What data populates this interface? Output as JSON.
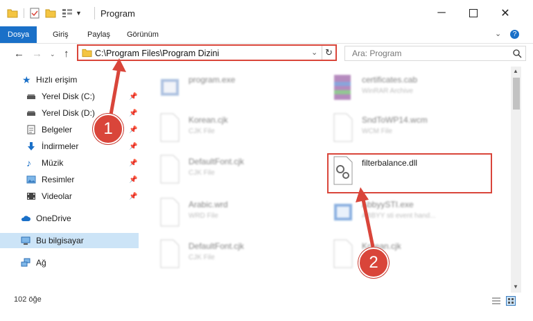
{
  "window": {
    "title": "Program"
  },
  "ribbon": {
    "tabs": [
      "Dosya",
      "Giriş",
      "Paylaş",
      "Görünüm"
    ]
  },
  "address": {
    "path": "C:\\Program Files\\Program Dizini"
  },
  "search": {
    "placeholder": "Ara: Program"
  },
  "sidebar": {
    "items": [
      {
        "label": "Hızlı erişim",
        "icon": "star-icon"
      },
      {
        "label": "Yerel Disk (C:)",
        "icon": "drive-icon",
        "pinned": true
      },
      {
        "label": "Yerel Disk (D:)",
        "icon": "drive-icon",
        "pinned": true
      },
      {
        "label": "Belgeler",
        "icon": "documents-icon",
        "pinned": true
      },
      {
        "label": "İndirmeler",
        "icon": "download-icon",
        "pinned": true
      },
      {
        "label": "Müzik",
        "icon": "music-icon",
        "pinned": true
      },
      {
        "label": "Resimler",
        "icon": "pictures-icon",
        "pinned": true
      },
      {
        "label": "Videolar",
        "icon": "videos-icon",
        "pinned": true
      },
      {
        "label": "OneDrive",
        "icon": "cloud-icon"
      },
      {
        "label": "Bu bilgisayar",
        "icon": "computer-icon",
        "selected": true
      },
      {
        "label": "Ağ",
        "icon": "network-icon"
      }
    ]
  },
  "files": [
    {
      "name": "program.exe",
      "type": ""
    },
    {
      "name": "certificates.cab",
      "type": "WinRAR Archive"
    },
    {
      "name": "Korean.cjk",
      "type": "CJK File"
    },
    {
      "name": "SndToWP14.wcm",
      "type": "WCM File"
    },
    {
      "name": "DefaultFont.cjk",
      "type": "CJK File"
    },
    {
      "name": "filterbalance.dll",
      "type": ""
    },
    {
      "name": "Arabic.wrd",
      "type": "WRD File"
    },
    {
      "name": "AbbyySTI.exe",
      "type": "ABBYY sti event hand..."
    },
    {
      "name": "DefaultFont.cjk",
      "type": "CJK File"
    },
    {
      "name": "Korean.cjk",
      "type": "CJK File"
    }
  ],
  "annotations": {
    "step1": "1",
    "step2": "2"
  },
  "status": {
    "count": "102 öğe"
  },
  "colors": {
    "accent": "#1a70c8",
    "highlight": "#d9453a",
    "selected": "#cce4f7"
  }
}
